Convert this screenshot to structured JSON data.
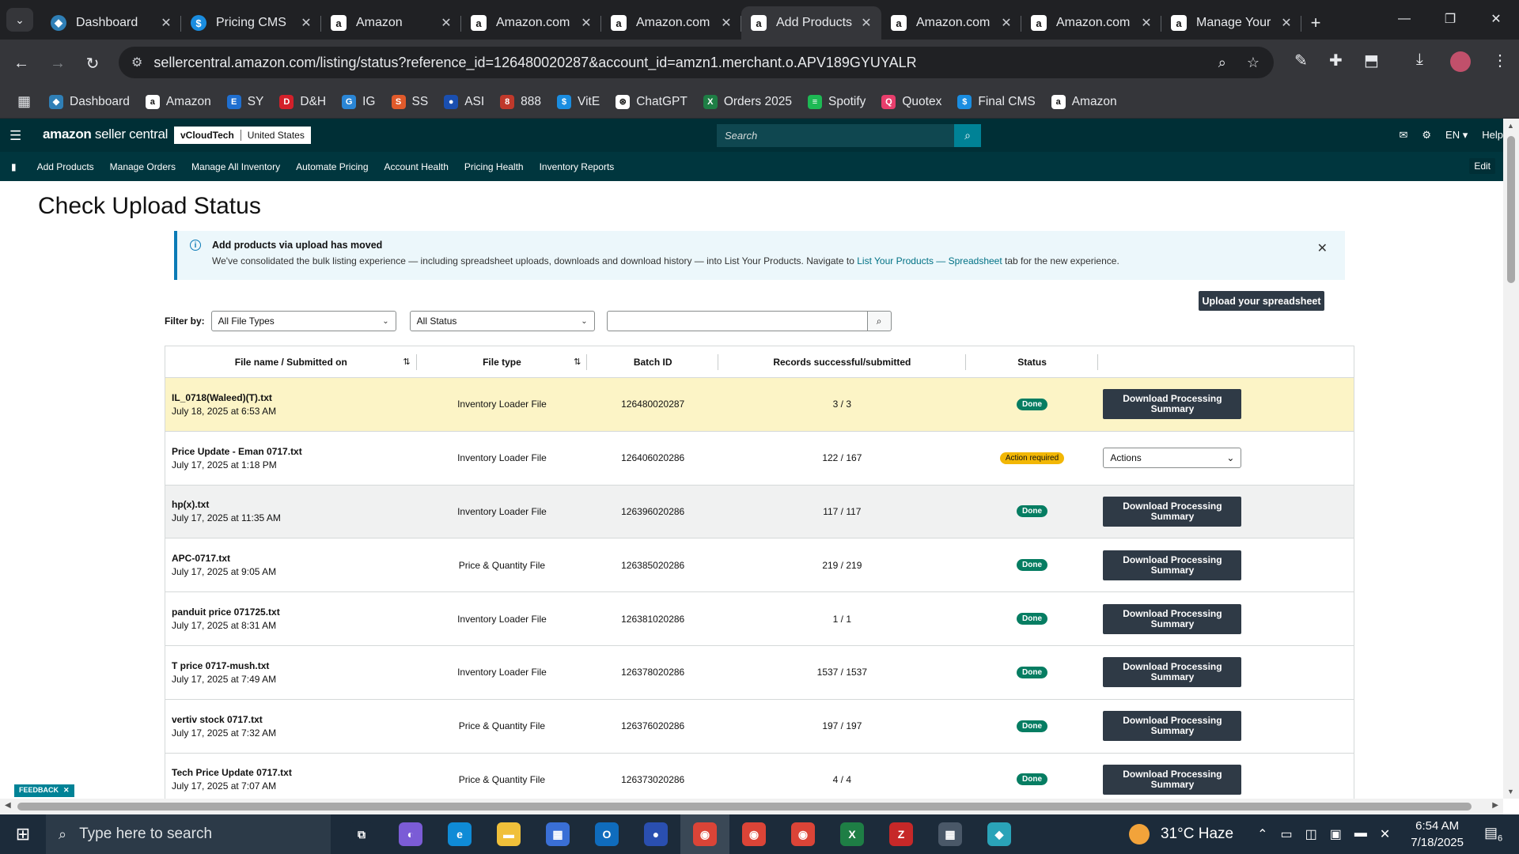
{
  "browser": {
    "tabs": [
      {
        "title": "Dashboard",
        "icon": "dashboard-favicon",
        "active": false
      },
      {
        "title": "Pricing CMS",
        "icon": "pricing-favicon",
        "active": false
      },
      {
        "title": "Amazon",
        "icon": "amazon-favicon",
        "active": false
      },
      {
        "title": "Amazon.com",
        "icon": "amazon-favicon",
        "active": false
      },
      {
        "title": "Amazon.com",
        "icon": "amazon-favicon",
        "active": false
      },
      {
        "title": "Add Products",
        "icon": "amazon-favicon",
        "active": true
      },
      {
        "title": "Amazon.com",
        "icon": "amazon-favicon",
        "active": false
      },
      {
        "title": "Amazon.com",
        "icon": "amazon-favicon",
        "active": false
      },
      {
        "title": "Manage Your",
        "icon": "amazon-favicon",
        "active": false
      }
    ],
    "url": "sellercentral.amazon.com/listing/status?reference_id=126480020287&account_id=amzn1.merchant.o.APV189GYUYALR",
    "bookmarks": [
      {
        "label": "Dashboard",
        "color": "#2f7fb6",
        "glyph": "◆"
      },
      {
        "label": "Amazon",
        "color": "#ffffff",
        "glyph": "a"
      },
      {
        "label": "SY",
        "color": "#1f6fd0",
        "glyph": "E"
      },
      {
        "label": "D&H",
        "color": "#d3202a",
        "glyph": "D"
      },
      {
        "label": "IG",
        "color": "#2a86d6",
        "glyph": "G"
      },
      {
        "label": "SS",
        "color": "#e05a2b",
        "glyph": "S"
      },
      {
        "label": "ASI",
        "color": "#1a4fb0",
        "glyph": "●"
      },
      {
        "label": "888",
        "color": "#c0392b",
        "glyph": "8"
      },
      {
        "label": "VitE",
        "color": "#1a8de0",
        "glyph": "$"
      },
      {
        "label": "ChatGPT",
        "color": "#ffffff",
        "glyph": "⊛"
      },
      {
        "label": "Orders 2025",
        "color": "#1e7e45",
        "glyph": "X"
      },
      {
        "label": "Spotify",
        "color": "#1db954",
        "glyph": "≡"
      },
      {
        "label": "Quotex",
        "color": "#e83e6c",
        "glyph": "Q"
      },
      {
        "label": "Final CMS",
        "color": "#1a8de0",
        "glyph": "$"
      },
      {
        "label": "Amazon",
        "color": "#ffffff",
        "glyph": "a"
      }
    ]
  },
  "seller_central": {
    "logo_bold": "amazon",
    "logo_light": " seller central",
    "account_name": "vCloudTech",
    "marketplace": "United States",
    "search_placeholder": "Search",
    "lang": "EN",
    "help": "Help",
    "nav": [
      "Add Products",
      "Manage Orders",
      "Manage All Inventory",
      "Automate Pricing",
      "Account Health",
      "Pricing Health",
      "Inventory Reports"
    ],
    "edit_label": "Edit"
  },
  "page": {
    "title": "Check Upload Status",
    "banner": {
      "title": "Add products via upload has moved",
      "body_pre": "We've consolidated the bulk listing experience — including spreadsheet uploads, downloads and download history — into List Your Products. Navigate to ",
      "link": "List Your Products — Spreadsheet",
      "body_post": " tab for the new experience."
    },
    "upload_button": "Upload your spreadsheet",
    "filter_label": "Filter by:",
    "file_type_filter": "All File Types",
    "status_filter": "All Status",
    "columns": [
      "File name / Submitted on",
      "File type",
      "Batch ID",
      "Records successful/submitted",
      "Status",
      ""
    ],
    "rows": [
      {
        "file": "IL_0718(Waleed)(T).txt",
        "date": "July 18, 2025 at 6:53 AM",
        "type": "Inventory Loader File",
        "batch": "126480020287",
        "records": "3 / 3",
        "status": "Done",
        "action": "Download Processing Summary"
      },
      {
        "file": "Price Update - Eman 0717.txt",
        "date": "July 17, 2025 at 1:18 PM",
        "type": "Inventory Loader File",
        "batch": "126406020286",
        "records": "122 / 167",
        "status": "Action required",
        "action": "Actions"
      },
      {
        "file": "hp(x).txt",
        "date": "July 17, 2025 at 11:35 AM",
        "type": "Inventory Loader File",
        "batch": "126396020286",
        "records": "117 / 117",
        "status": "Done",
        "action": "Download Processing Summary"
      },
      {
        "file": "APC-0717.txt",
        "date": "July 17, 2025 at 9:05 AM",
        "type": "Price & Quantity File",
        "batch": "126385020286",
        "records": "219 / 219",
        "status": "Done",
        "action": "Download Processing Summary"
      },
      {
        "file": "panduit price 071725.txt",
        "date": "July 17, 2025 at 8:31 AM",
        "type": "Inventory Loader File",
        "batch": "126381020286",
        "records": "1 / 1",
        "status": "Done",
        "action": "Download Processing Summary"
      },
      {
        "file": "T price 0717-mush.txt",
        "date": "July 17, 2025 at 7:49 AM",
        "type": "Inventory Loader File",
        "batch": "126378020286",
        "records": "1537 / 1537",
        "status": "Done",
        "action": "Download Processing Summary"
      },
      {
        "file": "vertiv stock 0717.txt",
        "date": "July 17, 2025 at 7:32 AM",
        "type": "Price & Quantity File",
        "batch": "126376020286",
        "records": "197 / 197",
        "status": "Done",
        "action": "Download Processing Summary"
      },
      {
        "file": "Tech Price Update 0717.txt",
        "date": "July 17, 2025 at 7:07 AM",
        "type": "Price & Quantity File",
        "batch": "126373020286",
        "records": "4 / 4",
        "status": "Done",
        "action": "Download Processing Summary"
      }
    ],
    "feedback": "FEEDBACK"
  },
  "taskbar": {
    "search_placeholder": "Type here to search",
    "apps": [
      {
        "name": "task-view",
        "color": "#1c2b3a",
        "glyph": "⧉"
      },
      {
        "name": "copilot",
        "color": "#7b5cd6",
        "glyph": "◐"
      },
      {
        "name": "edge",
        "color": "#0f8bd6",
        "glyph": "e"
      },
      {
        "name": "file-explorer",
        "color": "#f0c03a",
        "glyph": "▬"
      },
      {
        "name": "store",
        "color": "#3a6fd6",
        "glyph": "▦"
      },
      {
        "name": "outlook",
        "color": "#0f6cbd",
        "glyph": "O"
      },
      {
        "name": "app-badge",
        "color": "#2a4fb0",
        "glyph": "●"
      },
      {
        "name": "chrome",
        "color": "#db4437",
        "glyph": "◉"
      },
      {
        "name": "chrome-2",
        "color": "#db4437",
        "glyph": "◉"
      },
      {
        "name": "chrome-3",
        "color": "#db4437",
        "glyph": "◉"
      },
      {
        "name": "excel",
        "color": "#1e7e45",
        "glyph": "X"
      },
      {
        "name": "filezilla",
        "color": "#c62828",
        "glyph": "Z"
      },
      {
        "name": "calculator",
        "color": "#4a5868",
        "glyph": "▦"
      },
      {
        "name": "app-diamond",
        "color": "#2aa3b8",
        "glyph": "◆"
      }
    ],
    "weather": "31°C  Haze",
    "time": "6:54 AM",
    "date": "7/18/2025",
    "notifications": "6"
  }
}
